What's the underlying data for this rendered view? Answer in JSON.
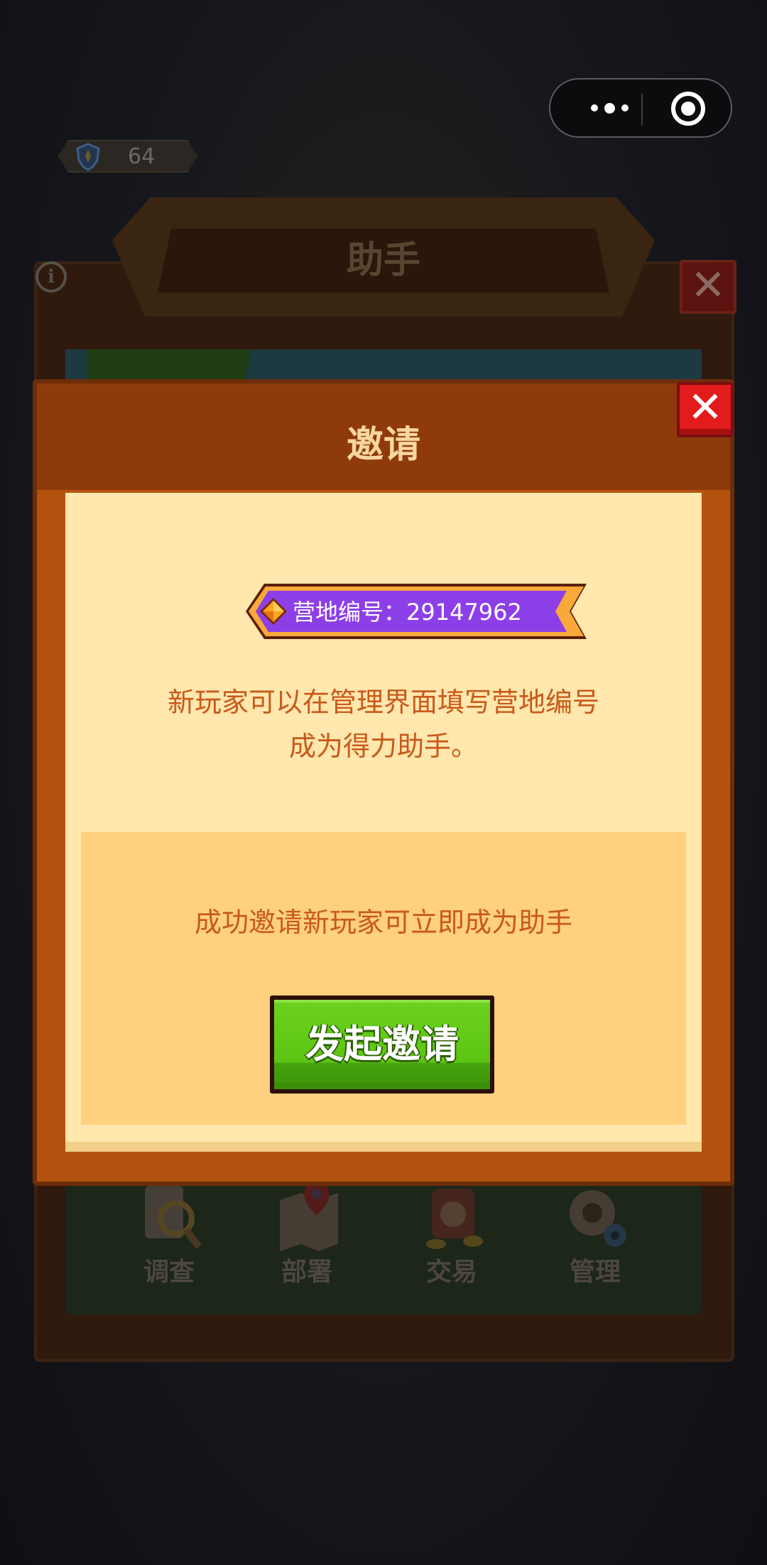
{
  "background": {
    "level_value": "64",
    "panel_title": "助手",
    "info_symbol": "i",
    "close_symbol": "✕",
    "tabs": [
      {
        "label": "调查",
        "icon": "magnifier-clipboard-icon"
      },
      {
        "label": "部署",
        "icon": "map-pin-icon"
      },
      {
        "label": "交易",
        "icon": "trade-scale-icon"
      },
      {
        "label": "管理",
        "icon": "gear-icon"
      }
    ]
  },
  "dialog": {
    "title": "邀请",
    "close_symbol": "✕",
    "camp_id_label": "营地编号：29147962",
    "description_line1": "新玩家可以在管理界面填写营地编号",
    "description_line2": "成为得力助手。",
    "invite_tip": "成功邀请新玩家可立即成为助手",
    "invite_button": "发起邀请"
  },
  "colors": {
    "dialog_frame": "#b3520e",
    "dialog_content": "#ffe7ad",
    "accent_text": "#c85a1b",
    "invite_button": "#5cc414",
    "close_button": "#e21c1c",
    "ribbon_purple": "#8d3fe7"
  }
}
